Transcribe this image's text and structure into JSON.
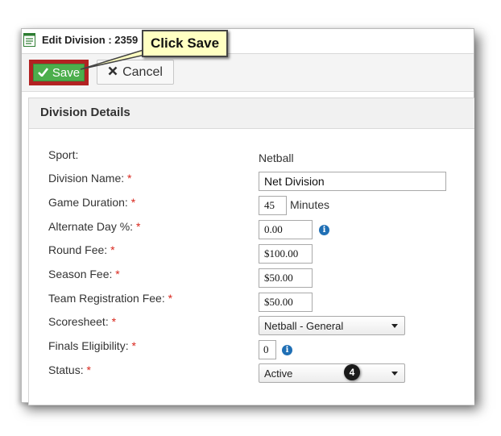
{
  "window": {
    "title": "Edit Division : 2359"
  },
  "toolbar": {
    "save_label": "Save",
    "cancel_label": "Cancel"
  },
  "callout": {
    "text": "Click Save"
  },
  "step_badge": "4",
  "panel": {
    "title": "Division Details"
  },
  "form": {
    "sport": {
      "label": "Sport:",
      "value": "Netball"
    },
    "division_name": {
      "label": "Division Name:",
      "required": "*",
      "value": "Net Division"
    },
    "game_duration": {
      "label": "Game Duration:",
      "required": "*",
      "value": "45",
      "unit": "Minutes"
    },
    "alternate_day": {
      "label": "Alternate Day %:",
      "required": "*",
      "value": "0.00"
    },
    "round_fee": {
      "label": "Round Fee:",
      "required": "*",
      "value": "$100.00"
    },
    "season_fee": {
      "label": "Season Fee:",
      "required": "*",
      "value": "$50.00"
    },
    "team_registration_fee": {
      "label": "Team Registration Fee:",
      "required": "*",
      "value": "$50.00"
    },
    "scoresheet": {
      "label": "Scoresheet:",
      "required": "*",
      "value": "Netball - General"
    },
    "finals_eligibility": {
      "label": "Finals Eligibility:",
      "required": "*",
      "value": "0"
    },
    "status": {
      "label": "Status:",
      "required": "*",
      "value": "Active"
    }
  },
  "icons": {
    "info": "info-icon",
    "save": "checkmark-icon",
    "cancel": "x-icon",
    "title": "form-icon"
  },
  "colors": {
    "save_button": "#4cae4c",
    "highlight_border": "#b22222",
    "callout_bg": "#ffffc2",
    "required": "#d9261c",
    "info": "#1f6fb5"
  }
}
